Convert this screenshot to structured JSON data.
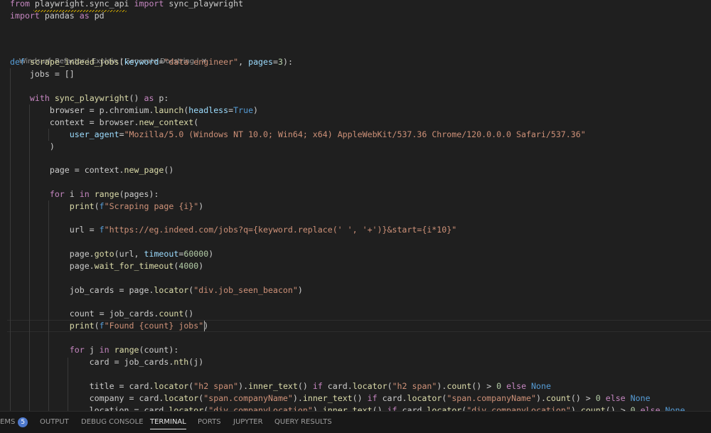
{
  "colors": {
    "keyword": "#c586c0",
    "storage": "#569cd6",
    "function": "#dcdcaa",
    "variable": "#9cdcfe",
    "string": "#ce9178",
    "number": "#b5cea8",
    "plain": "#cccccc",
    "constant": "#569cd6"
  },
  "code_lens": {
    "refactor": "Windsurf: Refactor",
    "sep1": " | ",
    "explain": "Explain",
    "sep2": " | ",
    "docstring": "Generate Docstring",
    "sep3": " | ",
    "close": "✕"
  },
  "lines": [
    {
      "tokens": [
        {
          "t": "from",
          "c": "keyword"
        },
        {
          "t": " ",
          "c": "plain"
        },
        {
          "t": "playwright.sync_api",
          "c": "plain"
        },
        {
          "t": " ",
          "c": "plain"
        },
        {
          "t": "import",
          "c": "keyword"
        },
        {
          "t": " sync_playwright",
          "c": "plain"
        }
      ]
    },
    {
      "tokens": [
        {
          "t": "import",
          "c": "keyword"
        },
        {
          "t": " pandas ",
          "c": "plain"
        },
        {
          "t": "as",
          "c": "keyword"
        },
        {
          "t": " pd",
          "c": "plain"
        }
      ]
    },
    {
      "tokens": [
        {
          "t": "def",
          "c": "storage"
        },
        {
          "t": " ",
          "c": "plain"
        },
        {
          "t": "scrape_indeed_jobs",
          "c": "function"
        },
        {
          "t": "(",
          "c": "plain"
        },
        {
          "t": "keyword",
          "c": "variable"
        },
        {
          "t": "=",
          "c": "plain"
        },
        {
          "t": "\"data engineer\"",
          "c": "string"
        },
        {
          "t": ", ",
          "c": "plain"
        },
        {
          "t": "pages",
          "c": "variable"
        },
        {
          "t": "=",
          "c": "plain"
        },
        {
          "t": "3",
          "c": "number"
        },
        {
          "t": "):",
          "c": "plain"
        }
      ]
    },
    {
      "tokens": [
        {
          "t": "    jobs = []",
          "c": "plain"
        }
      ]
    },
    {
      "tokens": [
        {
          "t": "    ",
          "c": "plain"
        },
        {
          "t": "with",
          "c": "keyword"
        },
        {
          "t": " ",
          "c": "plain"
        },
        {
          "t": "sync_playwright",
          "c": "function"
        },
        {
          "t": "() ",
          "c": "plain"
        },
        {
          "t": "as",
          "c": "keyword"
        },
        {
          "t": " p:",
          "c": "plain"
        }
      ]
    },
    {
      "tokens": [
        {
          "t": "        browser = p.chromium.",
          "c": "plain"
        },
        {
          "t": "launch",
          "c": "function"
        },
        {
          "t": "(",
          "c": "plain"
        },
        {
          "t": "headless",
          "c": "variable"
        },
        {
          "t": "=",
          "c": "plain"
        },
        {
          "t": "True",
          "c": "constant"
        },
        {
          "t": ")",
          "c": "plain"
        }
      ]
    },
    {
      "tokens": [
        {
          "t": "        context = browser.",
          "c": "plain"
        },
        {
          "t": "new_context",
          "c": "function"
        },
        {
          "t": "(",
          "c": "plain"
        }
      ]
    },
    {
      "tokens": [
        {
          "t": "            ",
          "c": "plain"
        },
        {
          "t": "user_agent",
          "c": "variable"
        },
        {
          "t": "=",
          "c": "plain"
        },
        {
          "t": "\"Mozilla/5.0 (Windows NT 10.0; Win64; x64) AppleWebKit/537.36 Chrome/120.0.0.0 Safari/537.36\"",
          "c": "string"
        }
      ]
    },
    {
      "tokens": [
        {
          "t": "        )",
          "c": "plain"
        }
      ]
    },
    {
      "tokens": [
        {
          "t": "        page = context.",
          "c": "plain"
        },
        {
          "t": "new_page",
          "c": "function"
        },
        {
          "t": "()",
          "c": "plain"
        }
      ]
    },
    {
      "tokens": [
        {
          "t": "        ",
          "c": "plain"
        },
        {
          "t": "for",
          "c": "keyword"
        },
        {
          "t": " i ",
          "c": "plain"
        },
        {
          "t": "in",
          "c": "keyword"
        },
        {
          "t": " ",
          "c": "plain"
        },
        {
          "t": "range",
          "c": "function"
        },
        {
          "t": "(pages):",
          "c": "plain"
        }
      ]
    },
    {
      "tokens": [
        {
          "t": "            ",
          "c": "plain"
        },
        {
          "t": "print",
          "c": "function"
        },
        {
          "t": "(",
          "c": "plain"
        },
        {
          "t": "f",
          "c": "storage"
        },
        {
          "t": "\"Scraping page {i}\"",
          "c": "string"
        },
        {
          "t": ")",
          "c": "plain"
        }
      ]
    },
    {
      "tokens": [
        {
          "t": "            url = ",
          "c": "plain"
        },
        {
          "t": "f",
          "c": "storage"
        },
        {
          "t": "\"https://eg.indeed.com/jobs?q={keyword.replace(' ', '+')}&start={i*10}\"",
          "c": "string"
        }
      ]
    },
    {
      "tokens": [
        {
          "t": "            page.",
          "c": "plain"
        },
        {
          "t": "goto",
          "c": "function"
        },
        {
          "t": "(url, ",
          "c": "plain"
        },
        {
          "t": "timeout",
          "c": "variable"
        },
        {
          "t": "=",
          "c": "plain"
        },
        {
          "t": "60000",
          "c": "number"
        },
        {
          "t": ")",
          "c": "plain"
        }
      ]
    },
    {
      "tokens": [
        {
          "t": "            page.",
          "c": "plain"
        },
        {
          "t": "wait_for_timeout",
          "c": "function"
        },
        {
          "t": "(",
          "c": "plain"
        },
        {
          "t": "4000",
          "c": "number"
        },
        {
          "t": ")",
          "c": "plain"
        }
      ]
    },
    {
      "tokens": [
        {
          "t": "            job_cards = page.",
          "c": "plain"
        },
        {
          "t": "locator",
          "c": "function"
        },
        {
          "t": "(",
          "c": "plain"
        },
        {
          "t": "\"div.job_seen_beacon\"",
          "c": "string"
        },
        {
          "t": ")",
          "c": "plain"
        }
      ]
    },
    {
      "tokens": [
        {
          "t": "            count = job_cards.",
          "c": "plain"
        },
        {
          "t": "count",
          "c": "function"
        },
        {
          "t": "()",
          "c": "plain"
        }
      ]
    },
    {
      "tokens": [
        {
          "t": "            ",
          "c": "plain"
        },
        {
          "t": "print",
          "c": "function"
        },
        {
          "t": "(",
          "c": "plain"
        },
        {
          "t": "f",
          "c": "storage"
        },
        {
          "t": "\"Found {count} jobs\"",
          "c": "string"
        },
        {
          "t": ")",
          "c": "plain"
        }
      ]
    },
    {
      "tokens": [
        {
          "t": "            ",
          "c": "plain"
        },
        {
          "t": "for",
          "c": "keyword"
        },
        {
          "t": " j ",
          "c": "plain"
        },
        {
          "t": "in",
          "c": "keyword"
        },
        {
          "t": " ",
          "c": "plain"
        },
        {
          "t": "range",
          "c": "function"
        },
        {
          "t": "(count):",
          "c": "plain"
        }
      ]
    },
    {
      "tokens": [
        {
          "t": "                card = job_cards.",
          "c": "plain"
        },
        {
          "t": "nth",
          "c": "function"
        },
        {
          "t": "(j)",
          "c": "plain"
        }
      ]
    },
    {
      "tokens": [
        {
          "t": "                title = card.",
          "c": "plain"
        },
        {
          "t": "locator",
          "c": "function"
        },
        {
          "t": "(",
          "c": "plain"
        },
        {
          "t": "\"h2 span\"",
          "c": "string"
        },
        {
          "t": ").",
          "c": "plain"
        },
        {
          "t": "inner_text",
          "c": "function"
        },
        {
          "t": "() ",
          "c": "plain"
        },
        {
          "t": "if",
          "c": "keyword"
        },
        {
          "t": " card.",
          "c": "plain"
        },
        {
          "t": "locator",
          "c": "function"
        },
        {
          "t": "(",
          "c": "plain"
        },
        {
          "t": "\"h2 span\"",
          "c": "string"
        },
        {
          "t": ").",
          "c": "plain"
        },
        {
          "t": "count",
          "c": "function"
        },
        {
          "t": "() > ",
          "c": "plain"
        },
        {
          "t": "0",
          "c": "number"
        },
        {
          "t": " ",
          "c": "plain"
        },
        {
          "t": "else",
          "c": "keyword"
        },
        {
          "t": " ",
          "c": "plain"
        },
        {
          "t": "None",
          "c": "constant"
        }
      ]
    },
    {
      "tokens": [
        {
          "t": "                company = card.",
          "c": "plain"
        },
        {
          "t": "locator",
          "c": "function"
        },
        {
          "t": "(",
          "c": "plain"
        },
        {
          "t": "\"span.companyName\"",
          "c": "string"
        },
        {
          "t": ").",
          "c": "plain"
        },
        {
          "t": "inner_text",
          "c": "function"
        },
        {
          "t": "() ",
          "c": "plain"
        },
        {
          "t": "if",
          "c": "keyword"
        },
        {
          "t": " card.",
          "c": "plain"
        },
        {
          "t": "locator",
          "c": "function"
        },
        {
          "t": "(",
          "c": "plain"
        },
        {
          "t": "\"span.companyName\"",
          "c": "string"
        },
        {
          "t": ").",
          "c": "plain"
        },
        {
          "t": "count",
          "c": "function"
        },
        {
          "t": "() > ",
          "c": "plain"
        },
        {
          "t": "0",
          "c": "number"
        },
        {
          "t": " ",
          "c": "plain"
        },
        {
          "t": "else",
          "c": "keyword"
        },
        {
          "t": " ",
          "c": "plain"
        },
        {
          "t": "None",
          "c": "constant"
        }
      ]
    },
    {
      "tokens": [
        {
          "t": "                location = card.",
          "c": "plain"
        },
        {
          "t": "locator",
          "c": "function"
        },
        {
          "t": "(",
          "c": "plain"
        },
        {
          "t": "\"div.companyLocation\"",
          "c": "string"
        },
        {
          "t": ").",
          "c": "plain"
        },
        {
          "t": "inner_text",
          "c": "function"
        },
        {
          "t": "() ",
          "c": "plain"
        },
        {
          "t": "if",
          "c": "keyword"
        },
        {
          "t": " card.",
          "c": "plain"
        },
        {
          "t": "locator",
          "c": "function"
        },
        {
          "t": "(",
          "c": "plain"
        },
        {
          "t": "\"div.companyLocation\"",
          "c": "string"
        },
        {
          "t": ").",
          "c": "plain"
        },
        {
          "t": "count",
          "c": "function"
        },
        {
          "t": "() > ",
          "c": "plain"
        },
        {
          "t": "0",
          "c": "number"
        },
        {
          "t": " ",
          "c": "plain"
        },
        {
          "t": "else",
          "c": "keyword"
        },
        {
          "t": " ",
          "c": "plain"
        },
        {
          "t": "None",
          "c": "constant"
        }
      ]
    }
  ],
  "panel": {
    "tabs": [
      {
        "label": "EMS",
        "badge": "5"
      },
      {
        "label": "OUTPUT"
      },
      {
        "label": "DEBUG CONSOLE"
      },
      {
        "label": "TERMINAL",
        "active": true
      },
      {
        "label": "PORTS"
      },
      {
        "label": "JUPYTER"
      },
      {
        "label": "QUERY RESULTS"
      }
    ]
  }
}
